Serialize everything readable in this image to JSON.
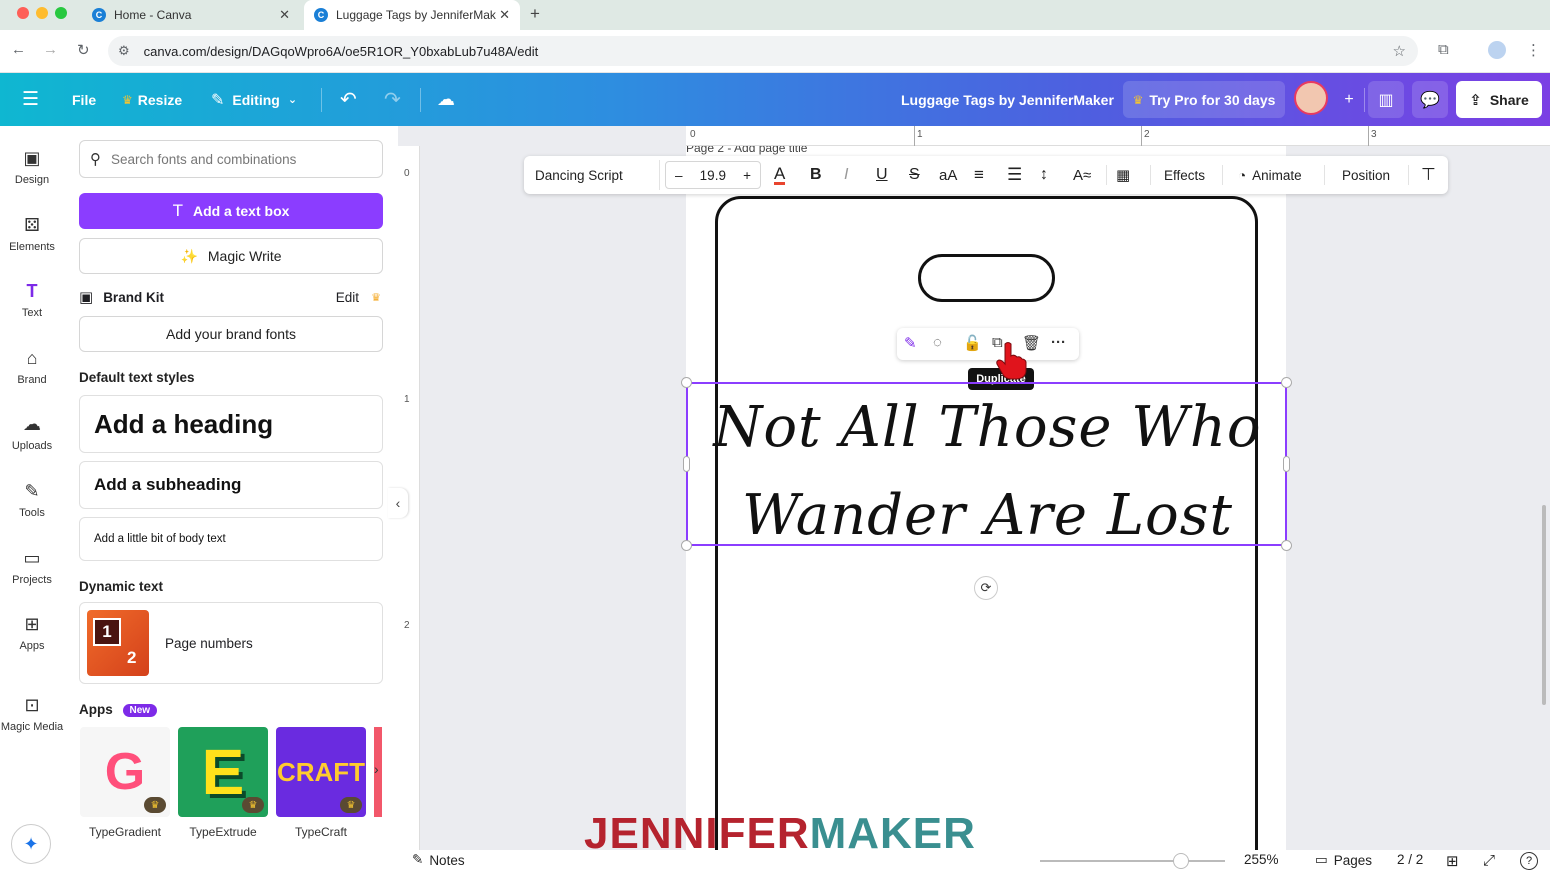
{
  "browser": {
    "tabs": [
      {
        "title": "Home - Canva",
        "active": false
      },
      {
        "title": "Luggage Tags by JenniferMak",
        "active": true
      }
    ],
    "url": "canva.com/design/DAGqoWpro6A/oe5R1OR_Y0bxabLub7u48A/edit"
  },
  "header": {
    "file_label": "File",
    "resize_label": "Resize",
    "editing_label": "Editing",
    "doc_title": "Luggage Tags by JenniferMaker",
    "try_pro_label": "Try Pro for 30 days",
    "share_label": "Share"
  },
  "rail": {
    "items": [
      {
        "label": "Design",
        "icon": "design-icon"
      },
      {
        "label": "Elements",
        "icon": "elements-icon"
      },
      {
        "label": "Text",
        "icon": "text-icon"
      },
      {
        "label": "Brand",
        "icon": "brand-icon"
      },
      {
        "label": "Uploads",
        "icon": "uploads-icon"
      },
      {
        "label": "Tools",
        "icon": "tools-icon"
      },
      {
        "label": "Projects",
        "icon": "projects-icon"
      },
      {
        "label": "Apps",
        "icon": "apps-icon"
      },
      {
        "label": "Magic Media",
        "icon": "magic-media-icon"
      }
    ]
  },
  "panel": {
    "search_placeholder": "Search fonts and combinations",
    "add_text_box": "Add a text box",
    "magic_write": "Magic Write",
    "brand_kit": "Brand Kit",
    "brand_kit_edit": "Edit",
    "add_brand_fonts": "Add your brand fonts",
    "default_styles_label": "Default text styles",
    "heading": "Add a heading",
    "subheading": "Add a subheading",
    "body": "Add a little bit of body text",
    "dynamic_text_label": "Dynamic text",
    "page_numbers": "Page numbers",
    "pn_thumb_1": "1",
    "pn_thumb_2": "2",
    "apps_label": "Apps",
    "new_badge": "New",
    "apps": [
      {
        "name": "TypeGradient",
        "glyph": "G"
      },
      {
        "name": "TypeExtrude",
        "glyph": "E"
      },
      {
        "name": "TypeCraft",
        "glyph": "CRAFT"
      }
    ]
  },
  "toolbar": {
    "font": "Dancing Script",
    "font_size": "19.9",
    "minus": "–",
    "plus": "+",
    "case_label": "aA",
    "effects": "Effects",
    "animate": "Animate",
    "position": "Position"
  },
  "ruler": {
    "top_ticks": [
      "0",
      "1",
      "2",
      "3"
    ],
    "left_ticks": [
      "0",
      "1",
      "2"
    ]
  },
  "canvas": {
    "page_title": "Page 2 - Add page title",
    "text_line1": "Not All Those Who",
    "text_line2": "Wander Are Lost",
    "tooltip": "Duplicate"
  },
  "footer": {
    "notes": "Notes",
    "zoom": "255%",
    "pages_label": "Pages",
    "page_count": "2 / 2",
    "zoom_level": 0.76
  },
  "watermark": {
    "part1": "JENNIFER",
    "part2": "MAKER"
  },
  "colors": {
    "brand_purple": "#8b3dff",
    "selection": "#8b3dff",
    "watermark_red": "#b5232e",
    "watermark_teal": "#3a8f90"
  }
}
